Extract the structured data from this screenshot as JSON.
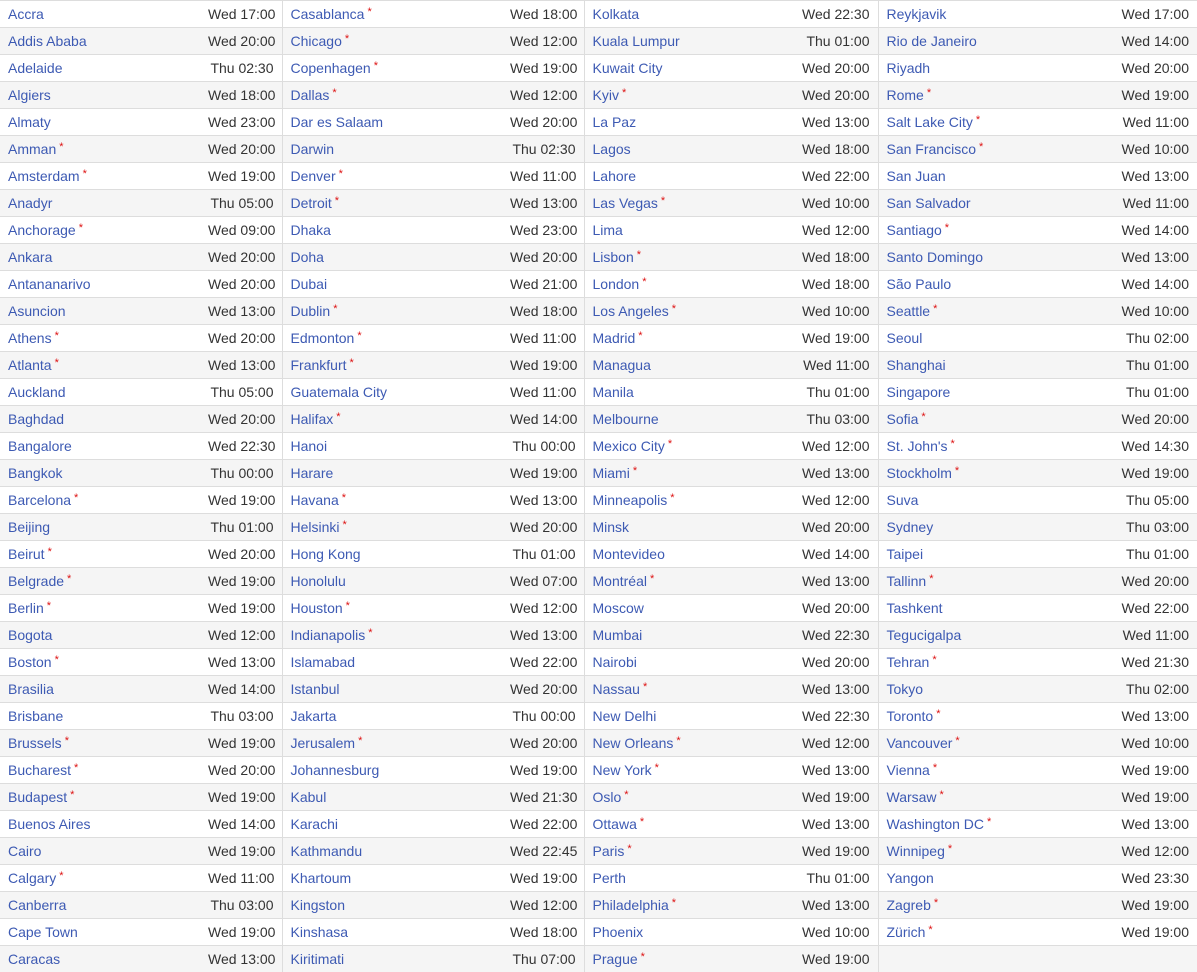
{
  "dst_marker": "*",
  "columns": [
    [
      [
        "Accra",
        "Wed 17:00",
        false
      ],
      [
        "Addis Ababa",
        "Wed 20:00",
        false
      ],
      [
        "Adelaide",
        "Thu 02:30",
        false
      ],
      [
        "Algiers",
        "Wed 18:00",
        false
      ],
      [
        "Almaty",
        "Wed 23:00",
        false
      ],
      [
        "Amman",
        "Wed 20:00",
        true
      ],
      [
        "Amsterdam",
        "Wed 19:00",
        true
      ],
      [
        "Anadyr",
        "Thu 05:00",
        false
      ],
      [
        "Anchorage",
        "Wed 09:00",
        true
      ],
      [
        "Ankara",
        "Wed 20:00",
        false
      ],
      [
        "Antananarivo",
        "Wed 20:00",
        false
      ],
      [
        "Asuncion",
        "Wed 13:00",
        false
      ],
      [
        "Athens",
        "Wed 20:00",
        true
      ],
      [
        "Atlanta",
        "Wed 13:00",
        true
      ],
      [
        "Auckland",
        "Thu 05:00",
        false
      ],
      [
        "Baghdad",
        "Wed 20:00",
        false
      ],
      [
        "Bangalore",
        "Wed 22:30",
        false
      ],
      [
        "Bangkok",
        "Thu 00:00",
        false
      ],
      [
        "Barcelona",
        "Wed 19:00",
        true
      ],
      [
        "Beijing",
        "Thu 01:00",
        false
      ],
      [
        "Beirut",
        "Wed 20:00",
        true
      ],
      [
        "Belgrade",
        "Wed 19:00",
        true
      ],
      [
        "Berlin",
        "Wed 19:00",
        true
      ],
      [
        "Bogota",
        "Wed 12:00",
        false
      ],
      [
        "Boston",
        "Wed 13:00",
        true
      ],
      [
        "Brasilia",
        "Wed 14:00",
        false
      ],
      [
        "Brisbane",
        "Thu 03:00",
        false
      ],
      [
        "Brussels",
        "Wed 19:00",
        true
      ],
      [
        "Bucharest",
        "Wed 20:00",
        true
      ],
      [
        "Budapest",
        "Wed 19:00",
        true
      ],
      [
        "Buenos Aires",
        "Wed 14:00",
        false
      ],
      [
        "Cairo",
        "Wed 19:00",
        false
      ],
      [
        "Calgary",
        "Wed 11:00",
        true
      ],
      [
        "Canberra",
        "Thu 03:00",
        false
      ],
      [
        "Cape Town",
        "Wed 19:00",
        false
      ],
      [
        "Caracas",
        "Wed 13:00",
        false
      ]
    ],
    [
      [
        "Casablanca",
        "Wed 18:00",
        true
      ],
      [
        "Chicago",
        "Wed 12:00",
        true
      ],
      [
        "Copenhagen",
        "Wed 19:00",
        true
      ],
      [
        "Dallas",
        "Wed 12:00",
        true
      ],
      [
        "Dar es Salaam",
        "Wed 20:00",
        false
      ],
      [
        "Darwin",
        "Thu 02:30",
        false
      ],
      [
        "Denver",
        "Wed 11:00",
        true
      ],
      [
        "Detroit",
        "Wed 13:00",
        true
      ],
      [
        "Dhaka",
        "Wed 23:00",
        false
      ],
      [
        "Doha",
        "Wed 20:00",
        false
      ],
      [
        "Dubai",
        "Wed 21:00",
        false
      ],
      [
        "Dublin",
        "Wed 18:00",
        true
      ],
      [
        "Edmonton",
        "Wed 11:00",
        true
      ],
      [
        "Frankfurt",
        "Wed 19:00",
        true
      ],
      [
        "Guatemala City",
        "Wed 11:00",
        false
      ],
      [
        "Halifax",
        "Wed 14:00",
        true
      ],
      [
        "Hanoi",
        "Thu 00:00",
        false
      ],
      [
        "Harare",
        "Wed 19:00",
        false
      ],
      [
        "Havana",
        "Wed 13:00",
        true
      ],
      [
        "Helsinki",
        "Wed 20:00",
        true
      ],
      [
        "Hong Kong",
        "Thu 01:00",
        false
      ],
      [
        "Honolulu",
        "Wed 07:00",
        false
      ],
      [
        "Houston",
        "Wed 12:00",
        true
      ],
      [
        "Indianapolis",
        "Wed 13:00",
        true
      ],
      [
        "Islamabad",
        "Wed 22:00",
        false
      ],
      [
        "Istanbul",
        "Wed 20:00",
        false
      ],
      [
        "Jakarta",
        "Thu 00:00",
        false
      ],
      [
        "Jerusalem",
        "Wed 20:00",
        true
      ],
      [
        "Johannesburg",
        "Wed 19:00",
        false
      ],
      [
        "Kabul",
        "Wed 21:30",
        false
      ],
      [
        "Karachi",
        "Wed 22:00",
        false
      ],
      [
        "Kathmandu",
        "Wed 22:45",
        false
      ],
      [
        "Khartoum",
        "Wed 19:00",
        false
      ],
      [
        "Kingston",
        "Wed 12:00",
        false
      ],
      [
        "Kinshasa",
        "Wed 18:00",
        false
      ],
      [
        "Kiritimati",
        "Thu 07:00",
        false
      ]
    ],
    [
      [
        "Kolkata",
        "Wed 22:30",
        false
      ],
      [
        "Kuala Lumpur",
        "Thu 01:00",
        false
      ],
      [
        "Kuwait City",
        "Wed 20:00",
        false
      ],
      [
        "Kyiv",
        "Wed 20:00",
        true
      ],
      [
        "La Paz",
        "Wed 13:00",
        false
      ],
      [
        "Lagos",
        "Wed 18:00",
        false
      ],
      [
        "Lahore",
        "Wed 22:00",
        false
      ],
      [
        "Las Vegas",
        "Wed 10:00",
        true
      ],
      [
        "Lima",
        "Wed 12:00",
        false
      ],
      [
        "Lisbon",
        "Wed 18:00",
        true
      ],
      [
        "London",
        "Wed 18:00",
        true
      ],
      [
        "Los Angeles",
        "Wed 10:00",
        true
      ],
      [
        "Madrid",
        "Wed 19:00",
        true
      ],
      [
        "Managua",
        "Wed 11:00",
        false
      ],
      [
        "Manila",
        "Thu 01:00",
        false
      ],
      [
        "Melbourne",
        "Thu 03:00",
        false
      ],
      [
        "Mexico City",
        "Wed 12:00",
        true
      ],
      [
        "Miami",
        "Wed 13:00",
        true
      ],
      [
        "Minneapolis",
        "Wed 12:00",
        true
      ],
      [
        "Minsk",
        "Wed 20:00",
        false
      ],
      [
        "Montevideo",
        "Wed 14:00",
        false
      ],
      [
        "Montréal",
        "Wed 13:00",
        true
      ],
      [
        "Moscow",
        "Wed 20:00",
        false
      ],
      [
        "Mumbai",
        "Wed 22:30",
        false
      ],
      [
        "Nairobi",
        "Wed 20:00",
        false
      ],
      [
        "Nassau",
        "Wed 13:00",
        true
      ],
      [
        "New Delhi",
        "Wed 22:30",
        false
      ],
      [
        "New Orleans",
        "Wed 12:00",
        true
      ],
      [
        "New York",
        "Wed 13:00",
        true
      ],
      [
        "Oslo",
        "Wed 19:00",
        true
      ],
      [
        "Ottawa",
        "Wed 13:00",
        true
      ],
      [
        "Paris",
        "Wed 19:00",
        true
      ],
      [
        "Perth",
        "Thu 01:00",
        false
      ],
      [
        "Philadelphia",
        "Wed 13:00",
        true
      ],
      [
        "Phoenix",
        "Wed 10:00",
        false
      ],
      [
        "Prague",
        "Wed 19:00",
        true
      ]
    ],
    [
      [
        "Reykjavik",
        "Wed 17:00",
        false
      ],
      [
        "Rio de Janeiro",
        "Wed 14:00",
        false
      ],
      [
        "Riyadh",
        "Wed 20:00",
        false
      ],
      [
        "Rome",
        "Wed 19:00",
        true
      ],
      [
        "Salt Lake City",
        "Wed 11:00",
        true
      ],
      [
        "San Francisco",
        "Wed 10:00",
        true
      ],
      [
        "San Juan",
        "Wed 13:00",
        false
      ],
      [
        "San Salvador",
        "Wed 11:00",
        false
      ],
      [
        "Santiago",
        "Wed 14:00",
        true
      ],
      [
        "Santo Domingo",
        "Wed 13:00",
        false
      ],
      [
        "São Paulo",
        "Wed 14:00",
        false
      ],
      [
        "Seattle",
        "Wed 10:00",
        true
      ],
      [
        "Seoul",
        "Thu 02:00",
        false
      ],
      [
        "Shanghai",
        "Thu 01:00",
        false
      ],
      [
        "Singapore",
        "Thu 01:00",
        false
      ],
      [
        "Sofia",
        "Wed 20:00",
        true
      ],
      [
        "St. John's",
        "Wed 14:30",
        true
      ],
      [
        "Stockholm",
        "Wed 19:00",
        true
      ],
      [
        "Suva",
        "Thu 05:00",
        false
      ],
      [
        "Sydney",
        "Thu 03:00",
        false
      ],
      [
        "Taipei",
        "Thu 01:00",
        false
      ],
      [
        "Tallinn",
        "Wed 20:00",
        true
      ],
      [
        "Tashkent",
        "Wed 22:00",
        false
      ],
      [
        "Tegucigalpa",
        "Wed 11:00",
        false
      ],
      [
        "Tehran",
        "Wed 21:30",
        true
      ],
      [
        "Tokyo",
        "Thu 02:00",
        false
      ],
      [
        "Toronto",
        "Wed 13:00",
        true
      ],
      [
        "Vancouver",
        "Wed 10:00",
        true
      ],
      [
        "Vienna",
        "Wed 19:00",
        true
      ],
      [
        "Warsaw",
        "Wed 19:00",
        true
      ],
      [
        "Washington DC",
        "Wed 13:00",
        true
      ],
      [
        "Winnipeg",
        "Wed 12:00",
        true
      ],
      [
        "Yangon",
        "Wed 23:30",
        false
      ],
      [
        "Zagreb",
        "Wed 19:00",
        true
      ],
      [
        "Zürich",
        "Wed 19:00",
        true
      ]
    ]
  ]
}
